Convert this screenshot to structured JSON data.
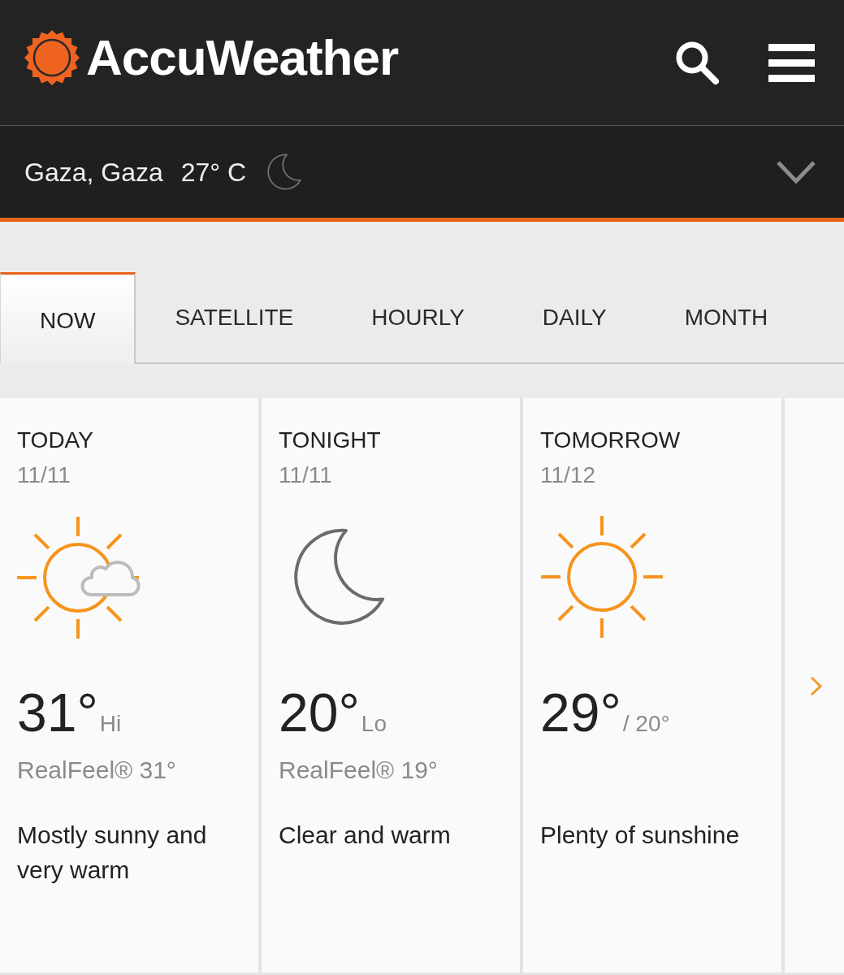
{
  "header": {
    "logo_text": "AccuWeather"
  },
  "location_bar": {
    "location": "Gaza, Gaza",
    "temperature": "27° C"
  },
  "tabs": [
    {
      "label": "NOW",
      "selected": true
    },
    {
      "label": "SATELLITE",
      "selected": false
    },
    {
      "label": "HOURLY",
      "selected": false
    },
    {
      "label": "DAILY",
      "selected": false
    },
    {
      "label": "MONTH",
      "selected": false
    }
  ],
  "forecast_cards": [
    {
      "kind": "partlysunny",
      "title": "TODAY",
      "date": "11/11",
      "temperature": "31°",
      "temperature_suffix": "Hi",
      "realfeel": "RealFeel® 31°",
      "phrase": "Mostly sunny and very warm"
    },
    {
      "kind": "clearnight",
      "title": "TONIGHT",
      "date": "11/11",
      "temperature": "20°",
      "temperature_suffix": "Lo",
      "realfeel": "RealFeel® 19°",
      "phrase": "Clear and warm"
    },
    {
      "kind": "sunny",
      "title": "TOMORROW",
      "date": "11/12",
      "temperature": "29°",
      "temperature_suffix": "/ 20°",
      "phrase": "Plenty of sunshine"
    }
  ]
}
